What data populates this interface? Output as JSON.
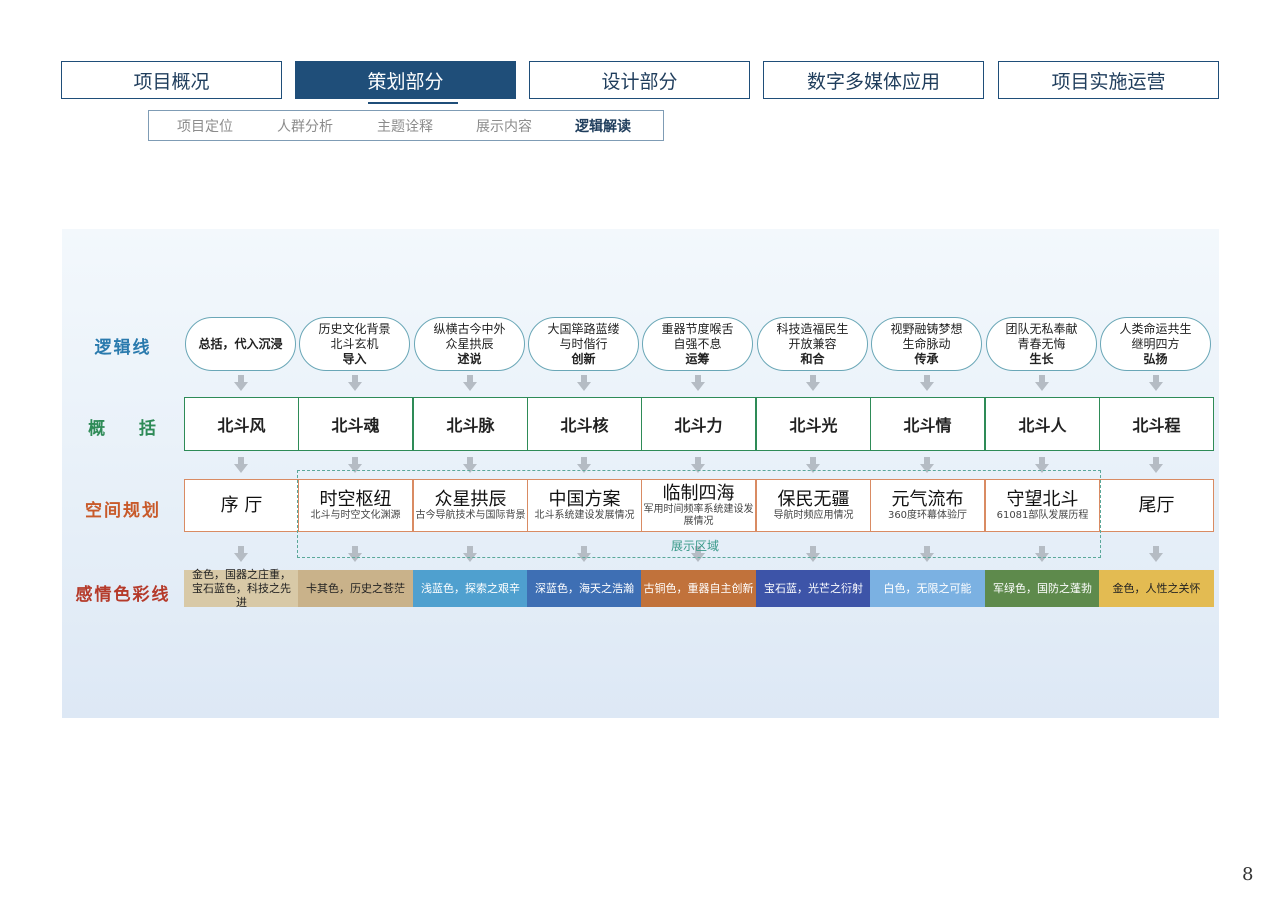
{
  "nav": {
    "main_tabs": [
      "项目概况",
      "策划部分",
      "设计部分",
      "数字多媒体应用",
      "项目实施运营"
    ],
    "sub_tabs": [
      "项目定位",
      "人群分析",
      "主题诠释",
      "展示内容",
      "逻辑解读"
    ]
  },
  "rows": {
    "logic": "逻辑线",
    "summary": "概    括",
    "space": "空间规划",
    "emotion": "感情色彩线"
  },
  "logic_pills": [
    {
      "l1": "总括，代入沉浸",
      "l2": "",
      "l3": ""
    },
    {
      "l1": "历史文化背景",
      "l2": "北斗玄机",
      "l3": "导入"
    },
    {
      "l1": "纵横古今中外",
      "l2": "众星拱辰",
      "l3": "述说"
    },
    {
      "l1": "大国筚路蓝缕",
      "l2": "与时偕行",
      "l3": "创新"
    },
    {
      "l1": "重器节度喉舌",
      "l2": "自强不息",
      "l3": "运筹"
    },
    {
      "l1": "科技造福民生",
      "l2": "开放兼容",
      "l3": "和合"
    },
    {
      "l1": "视野融铸梦想",
      "l2": "生命脉动",
      "l3": "传承"
    },
    {
      "l1": "团队无私奉献",
      "l2": "青春无悔",
      "l3": "生长"
    },
    {
      "l1": "人类命运共生",
      "l2": "继明四方",
      "l3": "弘扬"
    }
  ],
  "summary_cells": [
    "北斗风",
    "北斗魂",
    "北斗脉",
    "北斗核",
    "北斗力",
    "北斗光",
    "北斗情",
    "北斗人",
    "北斗程"
  ],
  "space_cells": [
    {
      "title": "序 厅",
      "sub": ""
    },
    {
      "title": "时空枢纽",
      "sub": "北斗与时空文化渊源"
    },
    {
      "title": "众星拱辰",
      "sub": "古今导航技术与国际背景"
    },
    {
      "title": "中国方案",
      "sub": "北斗系统建设发展情况"
    },
    {
      "title": "临制四海",
      "sub": "军用时间频率系统建设发展情况"
    },
    {
      "title": "保民无疆",
      "sub": "导航时频应用情况"
    },
    {
      "title": "元气流布",
      "sub": "360度环幕体验厅"
    },
    {
      "title": "守望北斗",
      "sub": "61081部队发展历程"
    },
    {
      "title": "尾厅",
      "sub": ""
    }
  ],
  "zone_label": "展示区域",
  "emotion_cells": [
    {
      "text": "金色，国器之庄重，宝石蓝色，科技之先进",
      "color": "#d8c9a7",
      "fg": "#222222"
    },
    {
      "text": "卡其色，历史之苍茫",
      "color": "#c9b28a",
      "fg": "#222222"
    },
    {
      "text": "浅蓝色，探索之艰辛",
      "color": "#4fa0cf",
      "fg": "#ffffff"
    },
    {
      "text": "深蓝色，海天之浩瀚",
      "color": "#3e6fb4",
      "fg": "#ffffff"
    },
    {
      "text": "古铜色，重器自主创新",
      "color": "#c1723b",
      "fg": "#ffffff"
    },
    {
      "text": "宝石蓝，光芒之衍射",
      "color": "#3d54a8",
      "fg": "#ffffff"
    },
    {
      "text": "白色，无限之可能",
      "color": "#7bb1e2",
      "fg": "#ffffff"
    },
    {
      "text": "军绿色，国防之蓬勃",
      "color": "#5e8a4c",
      "fg": "#ffffff"
    },
    {
      "text": "金色，人性之关怀",
      "color": "#e3bb52",
      "fg": "#222222"
    }
  ],
  "label_colors": {
    "logic": "#2a7aad",
    "summary": "#2e8b57",
    "space": "#c85a2a",
    "emotion": "#b53a2a"
  },
  "page_number": "8"
}
